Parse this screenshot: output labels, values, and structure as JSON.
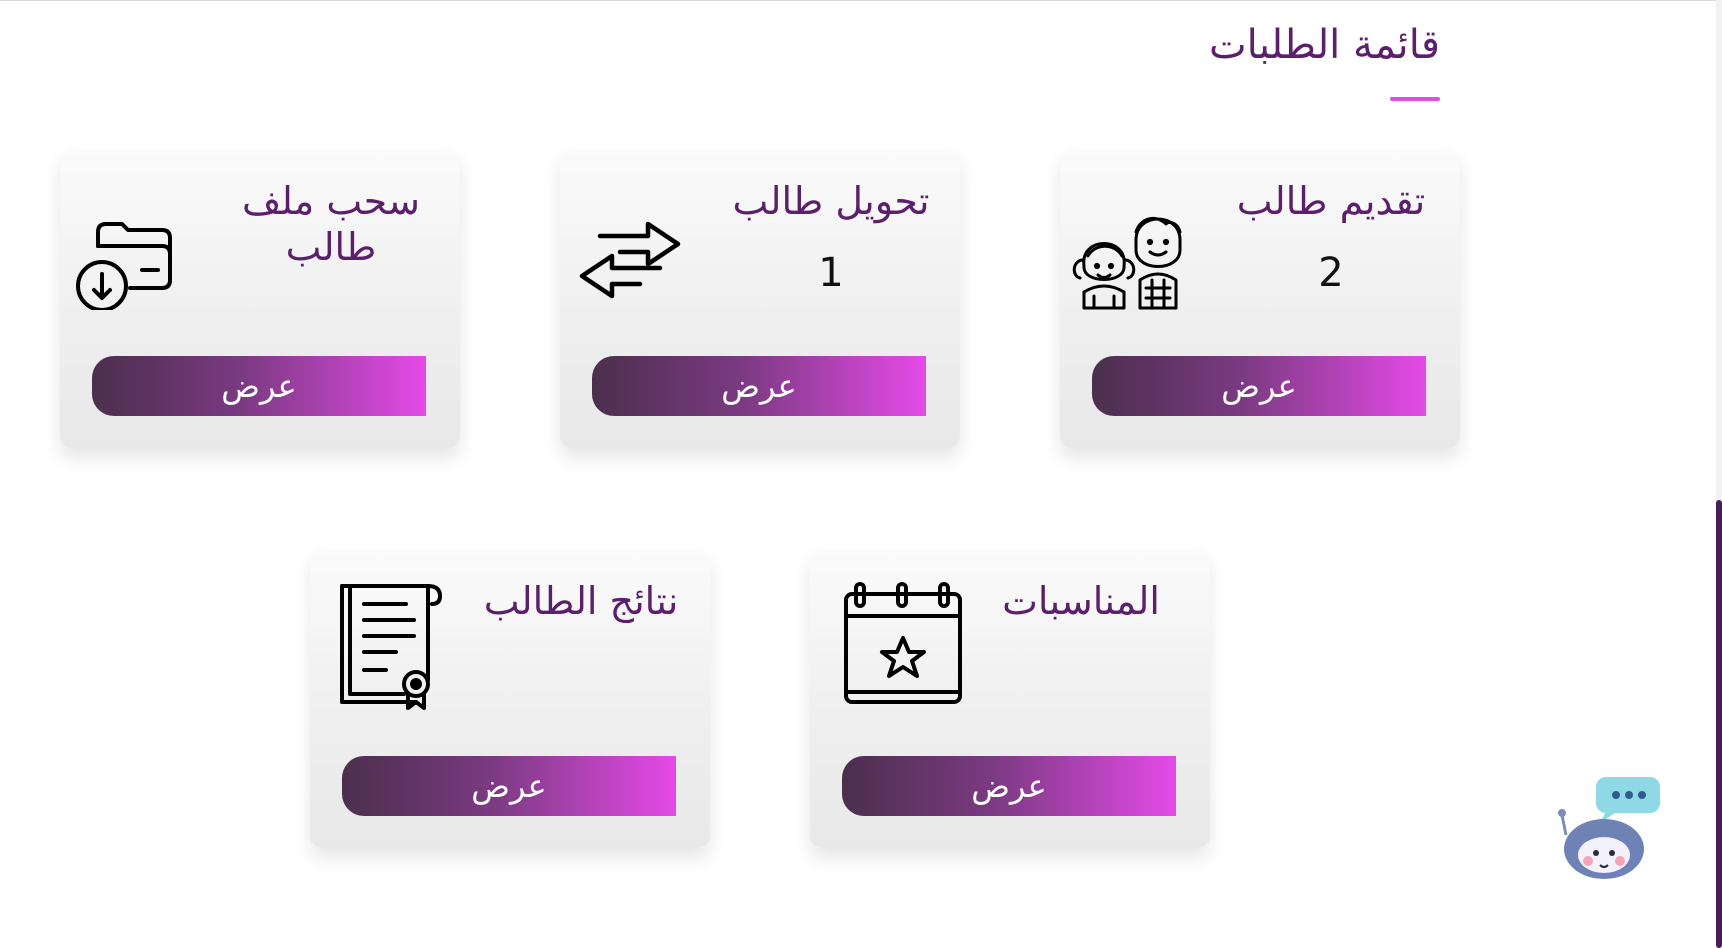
{
  "page": {
    "title": "قائمة الطلبات"
  },
  "cards": [
    {
      "title": "تقديم طالب",
      "count": "2",
      "icon": "students-icon",
      "button_label": "عرض"
    },
    {
      "title": "تحويل طالب",
      "count": "1",
      "icon": "transfer-arrows-icon",
      "button_label": "عرض"
    },
    {
      "title": "سحب ملف طالب",
      "count": "",
      "icon": "folder-download-icon",
      "button_label": "عرض"
    },
    {
      "title": "المناسبات",
      "count": "",
      "icon": "calendar-star-icon",
      "button_label": "عرض"
    },
    {
      "title": "نتائج الطالب",
      "count": "",
      "icon": "certificate-icon",
      "button_label": "عرض"
    }
  ],
  "chatbot": {
    "icon": "chatbot-icon"
  },
  "colors": {
    "accent": "#e04ee6",
    "title": "#5b1f6b",
    "button_start": "#4b2f4d",
    "button_end": "#e54ae8"
  }
}
